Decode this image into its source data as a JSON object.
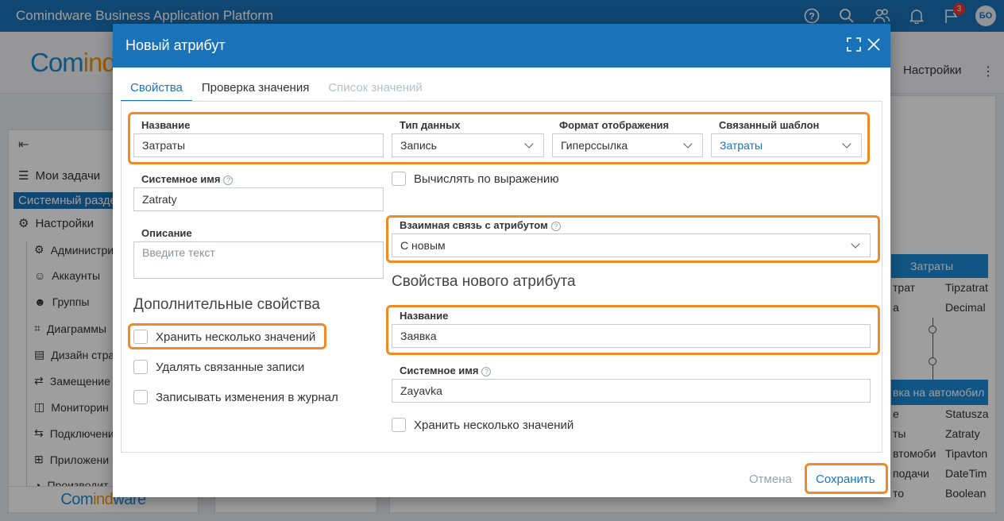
{
  "appbar": {
    "title": "Comindware Business Application Platform",
    "notifications_count": "3",
    "avatar_initials": "БО"
  },
  "background": {
    "brand_logo_part1": "Com",
    "brand_logo_part2": "ind",
    "settings_label": "Настройки",
    "sidebar": {
      "my_tasks": "Мои задачи",
      "system_section": "Системный разде",
      "settings": "Настройки",
      "sub_items": [
        "Администри",
        "Аккаунты",
        "Группы",
        "Диаграммы",
        "Дизайн стра",
        "Замещение",
        "Мониторин",
        "Подключени",
        "Приложени",
        "Производит"
      ]
    },
    "footer_logo_part1": "Com",
    "footer_logo_part2": "ind",
    "footer_logo_part3": "ware",
    "erd": {
      "header1": "Затраты",
      "header2": "вка на автомобил",
      "rows_top": [
        [
          "трат",
          "Tipzatrat"
        ],
        [
          "а",
          "Decimal"
        ]
      ],
      "rows_bottom": [
        [
          "е",
          "Statusza"
        ],
        [
          "ты",
          "Zatraty"
        ],
        [
          "втомоби",
          "Tipavton"
        ],
        [
          "подачи",
          "DateTim"
        ],
        [
          "то",
          "Boolean"
        ]
      ]
    }
  },
  "dialog": {
    "title": "Новый атрибут",
    "tabs": [
      {
        "label": "Свойства",
        "state": "active"
      },
      {
        "label": "Проверка значения",
        "state": "normal"
      },
      {
        "label": "Список значений",
        "state": "disabled"
      }
    ],
    "name_label": "Название",
    "name_value": "Затраты",
    "data_type_label": "Тип данных",
    "data_type_value": "Запись",
    "display_format_label": "Формат отображения",
    "display_format_value": "Гиперссылка",
    "linked_template_label": "Связанный шаблон",
    "linked_template_value": "Затраты",
    "system_name_label": "Системное имя",
    "system_name_value": "Zatraty",
    "compute_by_expression_label": "Вычислять по выражению",
    "description_label": "Описание",
    "description_placeholder": "Введите текст",
    "mutual_link_label": "Взаимная связь с атрибутом",
    "mutual_link_value": "С новым",
    "new_attr_section_title": "Свойства нового атрибута",
    "new_attr_name_label": "Название",
    "new_attr_name_value": "Заявка",
    "new_attr_system_name_label": "Системное имя",
    "new_attr_system_name_value": "Zayavka",
    "new_attr_multi_label": "Хранить несколько значений",
    "additional_section_title": "Дополнительные свойства",
    "store_multiple_label": "Хранить несколько значений",
    "delete_linked_label": "Удалять связанные записи",
    "log_changes_label": "Записывать изменения в журнал",
    "cancel_label": "Отмена",
    "save_label": "Сохранить",
    "help_glyph": "?"
  },
  "colors": {
    "accent": "#1a73b8",
    "highlight": "#f08a24"
  }
}
